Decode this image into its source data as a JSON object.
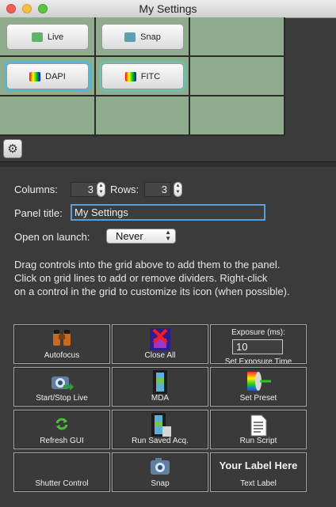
{
  "window": {
    "title": "My Settings"
  },
  "grid": {
    "buttons": [
      {
        "label": "Live",
        "icon": "live-icon"
      },
      {
        "label": "Snap",
        "icon": "snap-icon"
      },
      {
        "label": "DAPI",
        "icon": "dapi-preset-icon"
      },
      {
        "label": "FITC",
        "icon": "fitc-preset-icon"
      }
    ]
  },
  "form": {
    "columns_label": "Columns:",
    "columns_value": "3",
    "rows_label": "Rows:",
    "rows_value": "3",
    "panel_title_label": "Panel title:",
    "panel_title_value": "My Settings",
    "open_on_launch_label": "Open on launch:",
    "open_on_launch_value": "Never"
  },
  "help": {
    "line1": "Drag controls into the grid above to add them to the panel.",
    "line2": "Click on grid lines to add or remove dividers. Right-click",
    "line3": "on a control in the grid to customize its icon (when possible)."
  },
  "palette": {
    "autofocus": "Autofocus",
    "close_all": "Close All",
    "exposure_title": "Exposure (ms):",
    "exposure_value": "10",
    "exposure_cut": "Set Exposure Time",
    "start_stop_live": "Start/Stop Live",
    "mda": "MDA",
    "set_preset": "Set Preset",
    "refresh_gui": "Refresh GUI",
    "run_saved_acq": "Run Saved Acq.",
    "run_script": "Run Script",
    "shutter_control": "Shutter Control",
    "snap": "Snap",
    "your_label_here": "Your Label Here",
    "text_label": "Text Label"
  },
  "colors": {
    "grid_bg": "#8fad8c",
    "selected_outline": "#55b9d6",
    "field_focus": "#5b9fd8"
  }
}
